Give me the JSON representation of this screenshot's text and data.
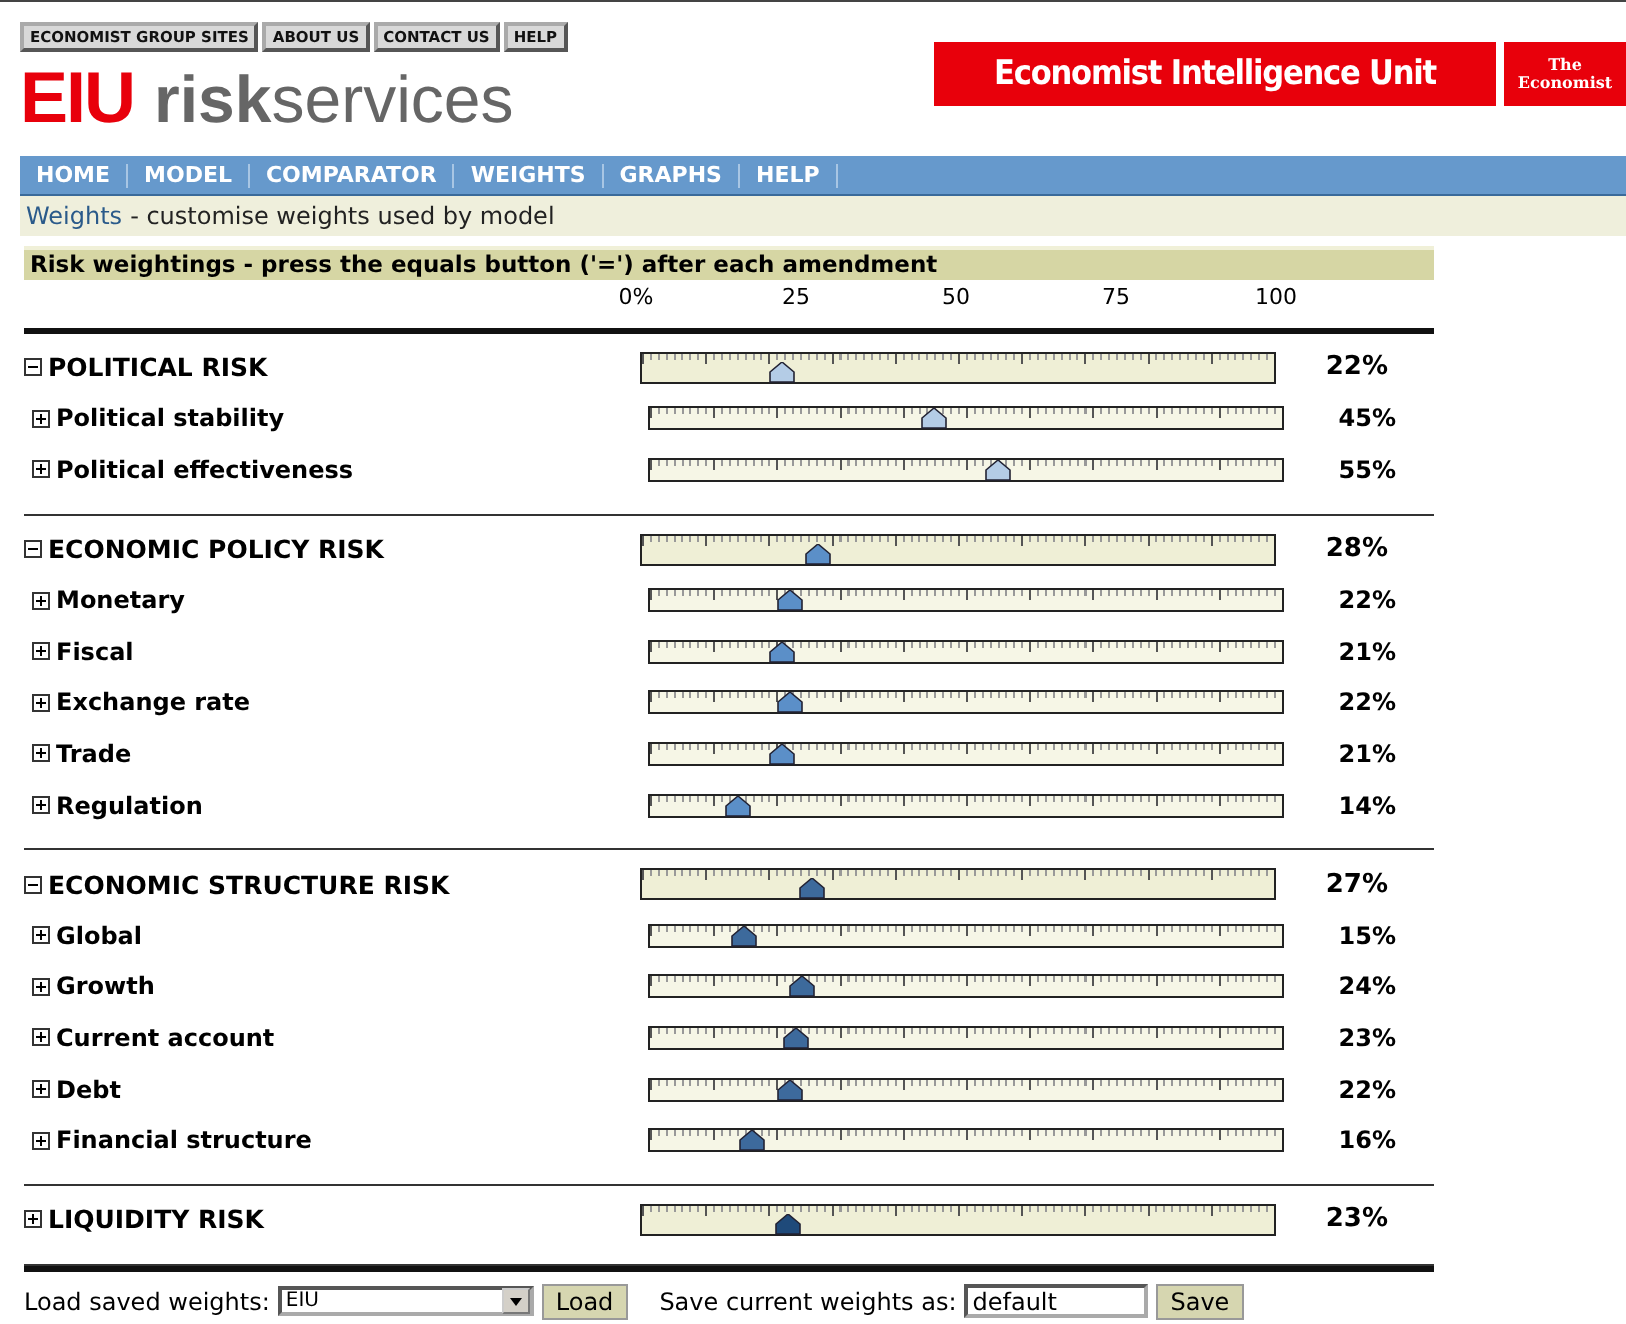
{
  "top_links": [
    "ECONOMIST GROUP SITES",
    "ABOUT US",
    "CONTACT US",
    "HELP"
  ],
  "logo": {
    "mark": "EIU",
    "bold": "risk",
    "rest": "services"
  },
  "banner": {
    "title": "Economist Intelligence Unit",
    "badge_line1": "The",
    "badge_line2": "Economist"
  },
  "nav": [
    {
      "label": "HOME"
    },
    {
      "label": "MODEL"
    },
    {
      "label": "COMPARATOR"
    },
    {
      "label": "WEIGHTS"
    },
    {
      "label": "GRAPHS"
    },
    {
      "label": "HELP"
    }
  ],
  "page_heading": {
    "title": "Weights",
    "subtitle": "- customise weights used by model"
  },
  "panel_title": "Risk weightings - press the equals button ('=') after each amendment",
  "scale": [
    "0%",
    "25",
    "50",
    "75",
    "100"
  ],
  "groups": [
    {
      "label": "POLITICAL RISK",
      "expanded": true,
      "color": "#b4cce6",
      "level": 0.22,
      "value": "22%",
      "children": [
        {
          "label": "Political stability",
          "expanded": false,
          "level": 0.45,
          "value": "45%"
        },
        {
          "label": "Political effectiveness",
          "expanded": false,
          "level": 0.55,
          "value": "55%"
        }
      ]
    },
    {
      "label": "ECONOMIC POLICY RISK",
      "expanded": true,
      "color": "#5b8fc8",
      "level": 0.28,
      "value": "28%",
      "children": [
        {
          "label": "Monetary",
          "expanded": false,
          "level": 0.22,
          "value": "22%"
        },
        {
          "label": "Fiscal",
          "expanded": false,
          "level": 0.21,
          "value": "21%"
        },
        {
          "label": "Exchange rate",
          "expanded": false,
          "level": 0.22,
          "value": "22%"
        },
        {
          "label": "Trade",
          "expanded": false,
          "level": 0.21,
          "value": "21%"
        },
        {
          "label": "Regulation",
          "expanded": false,
          "level": 0.14,
          "value": "14%"
        }
      ]
    },
    {
      "label": "ECONOMIC STRUCTURE RISK",
      "expanded": true,
      "color": "#3d6a9c",
      "level": 0.27,
      "value": "27%",
      "children": [
        {
          "label": "Global",
          "expanded": false,
          "level": 0.15,
          "value": "15%"
        },
        {
          "label": "Growth",
          "expanded": false,
          "level": 0.24,
          "value": "24%"
        },
        {
          "label": "Current account",
          "expanded": false,
          "level": 0.23,
          "value": "23%"
        },
        {
          "label": "Debt",
          "expanded": false,
          "level": 0.22,
          "value": "22%"
        },
        {
          "label": "Financial structure",
          "expanded": false,
          "level": 0.16,
          "value": "16%"
        }
      ]
    },
    {
      "label": "LIQUIDITY RISK",
      "expanded": false,
      "color": "#1f4a7a",
      "level": 0.23,
      "value": "23%"
    }
  ],
  "footer": {
    "load_label": "Load saved weights:",
    "load_value": "EIU",
    "load_button": "Load",
    "save_label": "Save current weights as:",
    "save_value": "default",
    "save_button": "Save"
  }
}
